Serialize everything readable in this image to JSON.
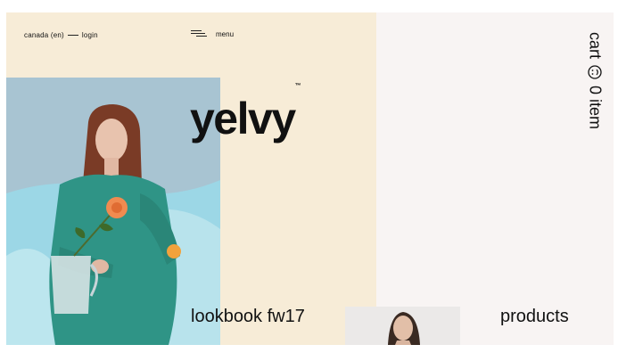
{
  "header": {
    "region": "canada (en)",
    "login": "login",
    "menu_label": "menu"
  },
  "brand": {
    "name": "yelvy",
    "trademark": "™"
  },
  "cart": {
    "label": "cart",
    "count": "0 item",
    "icon": "smiley-icon"
  },
  "sections": {
    "lookbook": "lookbook fw17",
    "products": "products"
  },
  "colors": {
    "left_panel": "#f7ecd7",
    "right_panel": "#f8f4f3",
    "hero_bg": "#a9c6d3",
    "sweater": "#2f9486"
  }
}
